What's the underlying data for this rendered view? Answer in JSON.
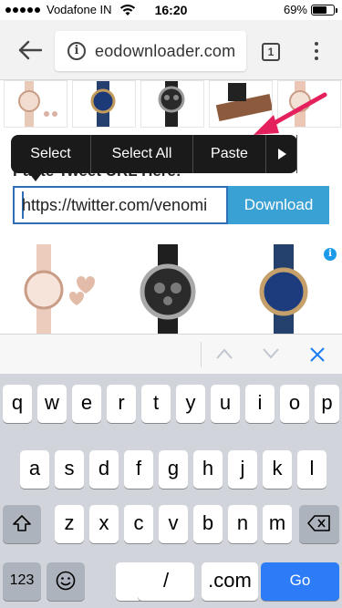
{
  "status_bar": {
    "carrier": "Vodafone IN",
    "time": "16:20",
    "battery": "69%",
    "battery_level": 0.69
  },
  "browser": {
    "url_text": "eodownloader.com",
    "tab_count": "1"
  },
  "page": {
    "heading_partial": "Paste Tweet URL Here:",
    "url_input_value": "https://twitter.com/venomi",
    "download_label": "Download",
    "ad_badge": "i"
  },
  "context_menu": {
    "items": [
      "Select",
      "Select All",
      "Paste"
    ],
    "more_icon": "triangle-right-icon"
  },
  "keyboard": {
    "row1": [
      "q",
      "w",
      "e",
      "r",
      "t",
      "y",
      "u",
      "i",
      "o",
      "p"
    ],
    "row2": [
      "a",
      "s",
      "d",
      "f",
      "g",
      "h",
      "j",
      "k",
      "l"
    ],
    "row3": [
      "z",
      "x",
      "c",
      "v",
      "b",
      "n",
      "m"
    ],
    "numbers_key": "123",
    "dot_key": ".",
    "slash_key": "/",
    "com_key": ".com",
    "go_key": "Go"
  },
  "colors": {
    "download_button": "#3aa1d5",
    "input_border": "#2f6fb7",
    "context_menu_bg": "#1a1a1a",
    "annotation_arrow": "#e5215d",
    "go_key": "#2b7cf6",
    "keyboard_bg": "#d1d5db"
  }
}
